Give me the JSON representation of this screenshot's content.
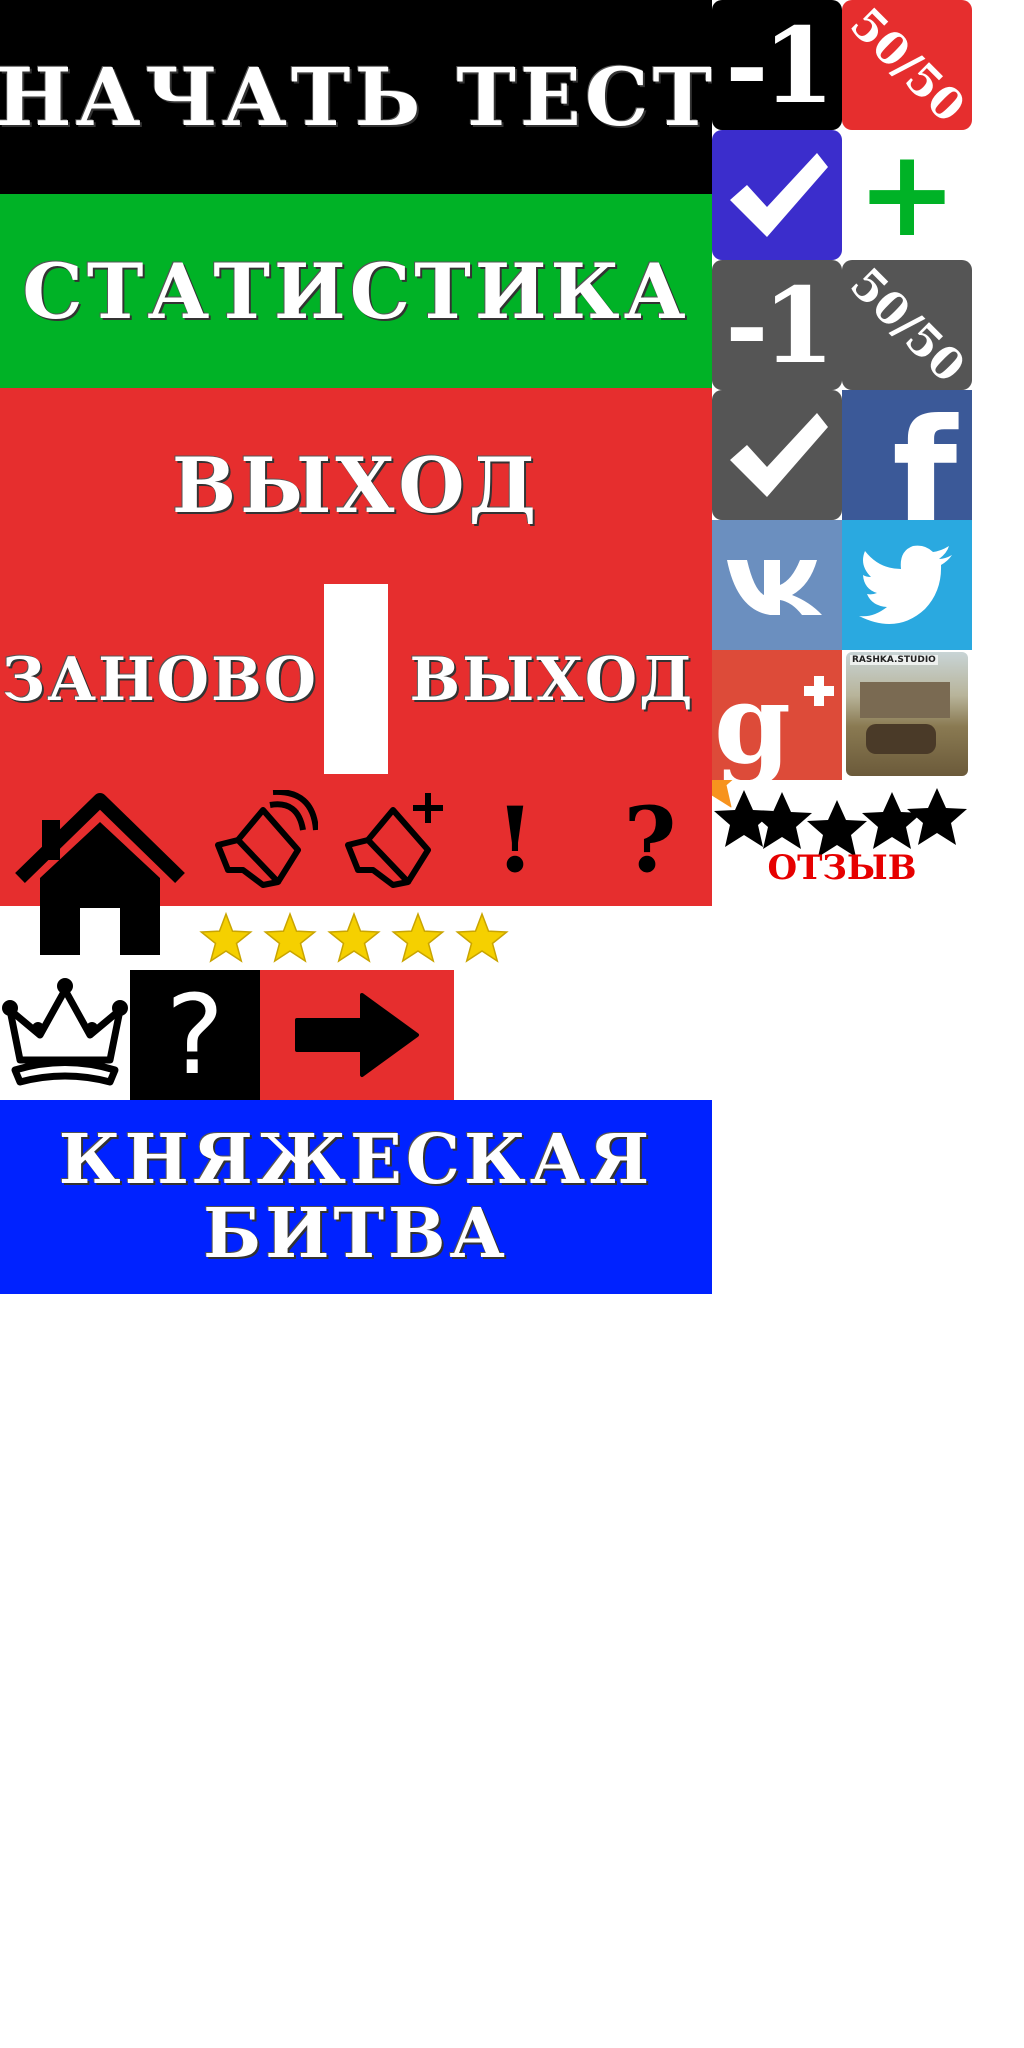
{
  "menu": {
    "start_test": "НАЧАТЬ ТЕСТ",
    "statistics": "СТАТИСТИКА",
    "exit": "ВЫХОД",
    "again": "ЗАНОВО",
    "exit2": "ВЫХОД"
  },
  "title": {
    "line1": "КНЯЖЕСКАЯ",
    "line2": "БИТВА"
  },
  "icons": {
    "minus_one": "-1",
    "fifty_fifty": "50/50",
    "exclaim": "!",
    "question": "?",
    "question2": "?",
    "plus": "+",
    "fb": "f",
    "studio": "RASHKA.STUDIO"
  },
  "rating": {
    "stars": 5,
    "max": 5
  },
  "review": {
    "label": "ОТЗЫВ"
  },
  "colors": {
    "black": "#000000",
    "green": "#00b226",
    "red": "#e62e2e",
    "blue": "#0022ff",
    "purple": "#3b2dcc",
    "gray": "#555555",
    "facebook": "#3b5998",
    "vk": "#6b8fbf",
    "twitter": "#2aa9e0",
    "gplus": "#dd4b39",
    "star": "#f5d000",
    "orange": "#f7931e"
  }
}
